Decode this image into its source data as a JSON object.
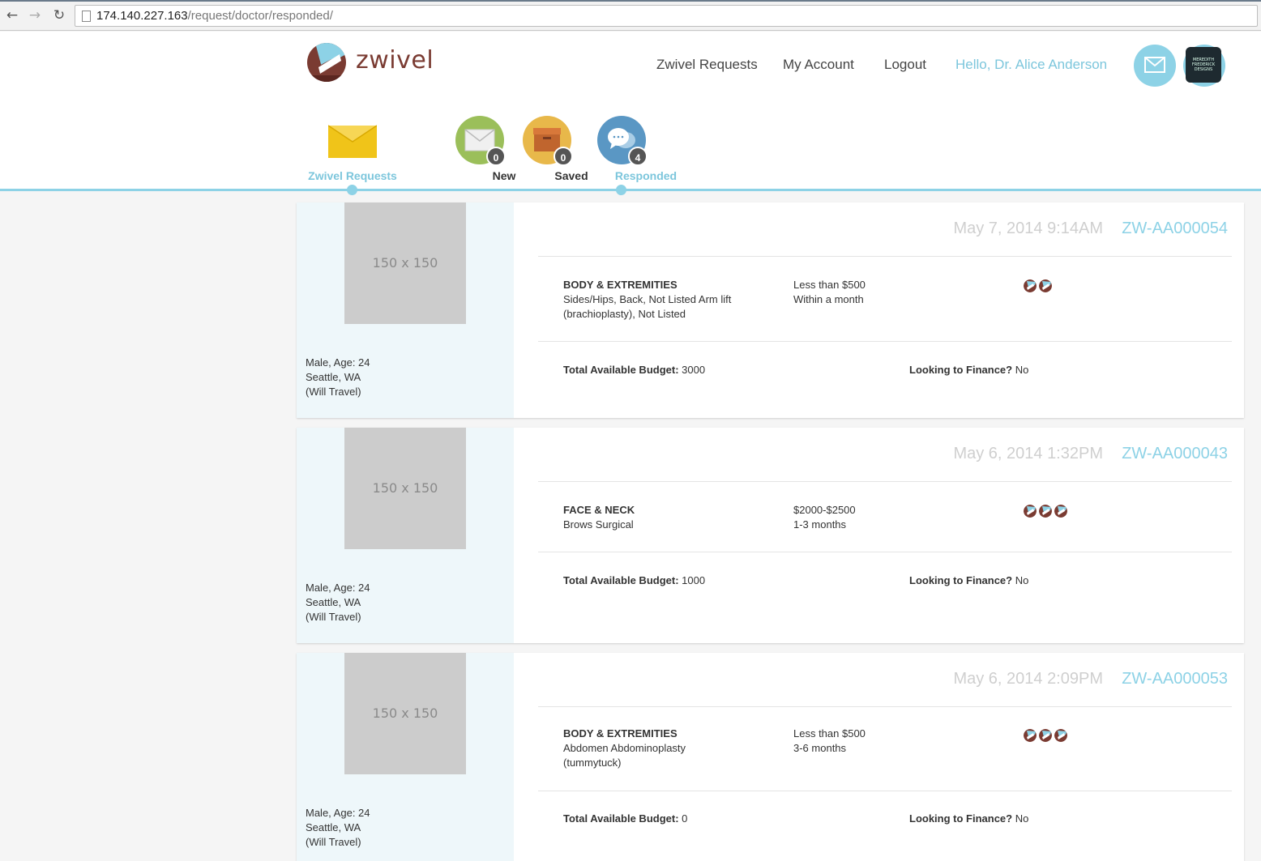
{
  "browser": {
    "url_host": "174.140.227.163",
    "url_path": "/request/doctor/responded/"
  },
  "logo": {
    "text": "zwivel"
  },
  "nav": {
    "requests": "Zwivel Requests",
    "account": "My Account",
    "logout": "Logout",
    "hello": "Hello, Dr. Alice Anderson"
  },
  "avatar": {
    "text": "MEREDITH FREDERICK DESIGNS"
  },
  "tabs": [
    {
      "label": "Zwivel Requests",
      "icon": "envelope-icon",
      "color": "#f0c419"
    },
    {
      "label": "New",
      "count": "0",
      "icon": "mail-icon",
      "color": "#9bbf5a"
    },
    {
      "label": "Saved",
      "count": "0",
      "icon": "box-icon",
      "color": "#e8b84a"
    },
    {
      "label": "Responded",
      "count": "4",
      "icon": "chat-icon",
      "color": "#5a97c4"
    }
  ],
  "colors": {
    "accent": "#8dd2e6",
    "brand": "#7a3b32"
  },
  "requests": [
    {
      "placeholder": "150 x 150",
      "patient": [
        "Male, Age: 24",
        "Seattle, WA",
        "(Will Travel)"
      ],
      "date": "May 7, 2014 9:14AM",
      "code": "ZW-AA000054",
      "category": "BODY & EXTREMITIES",
      "procedures": "Sides/Hips, Back, Not Listed Arm lift (brachioplasty), Not Listed",
      "price": "Less than $500",
      "timeframe": "Within a month",
      "responses": 2,
      "budget_label": "Total Available Budget:",
      "budget": "3000",
      "finance_label": "Looking to Finance?",
      "finance": "No"
    },
    {
      "placeholder": "150 x 150",
      "patient": [
        "Male, Age: 24",
        "Seattle, WA",
        "(Will Travel)"
      ],
      "date": "May 6, 2014 1:32PM",
      "code": "ZW-AA000043",
      "category": "FACE & NECK",
      "procedures": "Brows Surgical",
      "price": "$2000-$2500",
      "timeframe": "1-3 months",
      "responses": 3,
      "budget_label": "Total Available Budget:",
      "budget": "1000",
      "finance_label": "Looking to Finance?",
      "finance": "No"
    },
    {
      "placeholder": "150 x 150",
      "patient": [
        "Male, Age: 24",
        "Seattle, WA",
        "(Will Travel)"
      ],
      "date": "May 6, 2014 2:09PM",
      "code": "ZW-AA000053",
      "category": "BODY & EXTREMITIES",
      "procedures": "Abdomen Abdominoplasty (tummytuck)",
      "price": "Less than $500",
      "timeframe": "3-6 months",
      "responses": 3,
      "budget_label": "Total Available Budget:",
      "budget": "0",
      "finance_label": "Looking to Finance?",
      "finance": "No"
    }
  ]
}
